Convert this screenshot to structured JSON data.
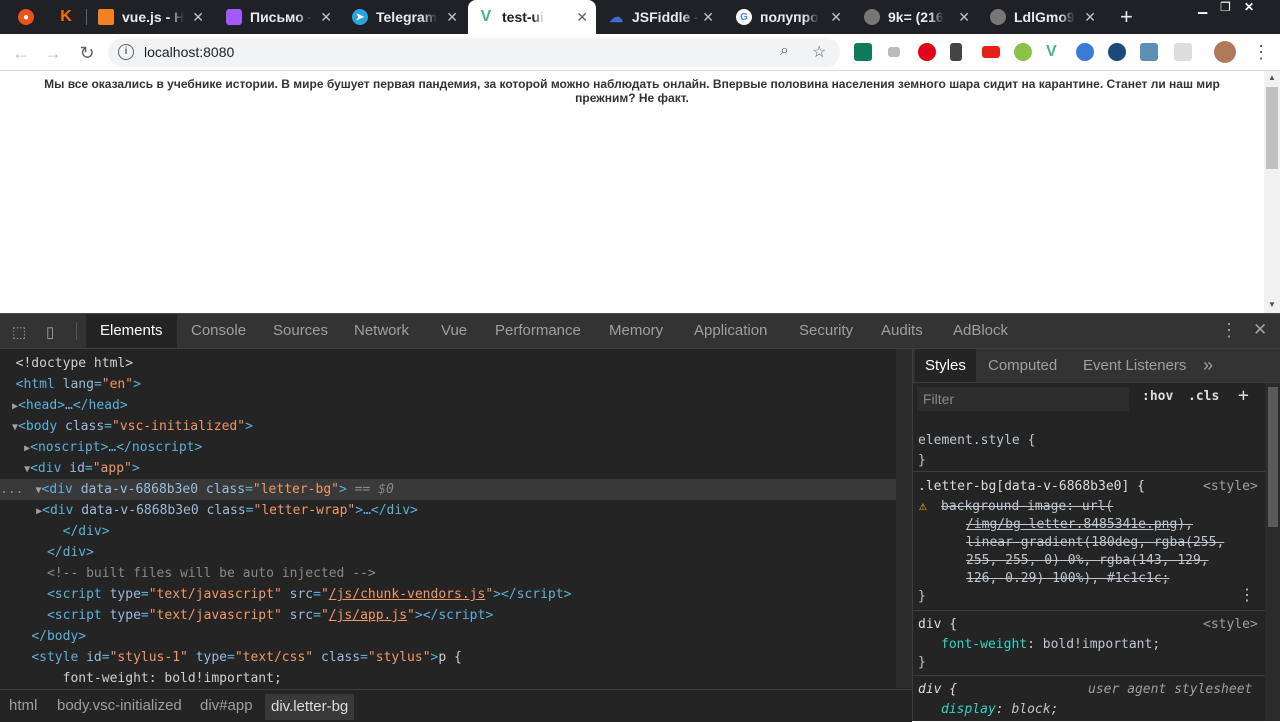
{
  "browser": {
    "tabs": [
      {
        "label": "",
        "icon": "firefox-like-icon",
        "color": "#e8541c"
      },
      {
        "label": "K",
        "icon": "k-icon",
        "color": "#ff6c00"
      },
      {
        "label": "vue.js - Н",
        "icon": "stackoverflow-icon",
        "color": "#f48024"
      },
      {
        "label": "Письмо -",
        "icon": "figma-icon",
        "color": "#a259ff"
      },
      {
        "label": "Telegram",
        "icon": "telegram-icon",
        "color": "#2aa3df"
      },
      {
        "label": "test-ui",
        "icon": "vue-icon",
        "color": "#41b883"
      },
      {
        "label": "JSFiddle -",
        "icon": "jsfiddle-icon",
        "color": "#3b6ed6"
      },
      {
        "label": "полупро",
        "icon": "google-icon",
        "color": "#4285f4"
      },
      {
        "label": "9k= (216",
        "icon": "globe-icon",
        "color": "#777"
      },
      {
        "label": "LdlGmo9",
        "icon": "globe-icon",
        "color": "#777"
      }
    ],
    "new_tab": "+",
    "url": "localhost:8080"
  },
  "page": {
    "paragraph": "Мы все оказались в учебнике истории. В мире бушует первая пандемия, за которой можно наблюдать онлайн. Впервые половина населения земного шара сидит на карантине. Станет ли наш мир прежним? Не факт."
  },
  "devtools": {
    "tabs": [
      "Elements",
      "Console",
      "Sources",
      "Network",
      "Vue",
      "Performance",
      "Memory",
      "Application",
      "Security",
      "Audits",
      "AdBlock"
    ],
    "dom": {
      "doctype": "<!doctype html>",
      "html_tag": "html",
      "html_attr": "lang",
      "html_val": "\"en\"",
      "head": "head",
      "head_ellipsis": "…</head>",
      "body_attr": "class",
      "body_val": "\"vsc-initialized\"",
      "noscript": "noscript",
      "noscript_ellipsis": "…</noscript>",
      "div_app_attr": "id",
      "div_app_val": "\"app\"",
      "sel_attr1": "data-v-6868b3e0",
      "sel_attr2": "class",
      "sel_val2": "\"letter-bg\"",
      "sel_marker": "== $0",
      "wrap_val": "\"letter-wrap\"",
      "wrap_ellipsis": "…</div>",
      "close_div": "</div>",
      "comment": "<!-- built files will be auto injected -->",
      "script_type": "\"text/javascript\"",
      "script1_src": "/js/chunk-vendors.js",
      "script2_src": "/js/app.js",
      "close_body": "</body>",
      "style_id": "\"stylus-1\"",
      "style_type": "\"text/css\"",
      "style_class": "\"stylus\"",
      "style_text": "p {",
      "style_rule": "font-weight: bold!important;"
    },
    "breadcrumbs": [
      "html",
      "body.vsc-initialized",
      "div#app",
      "div.letter-bg"
    ],
    "styles_panel": {
      "tabs": [
        "Styles",
        "Computed",
        "Event Listeners"
      ],
      "filter_placeholder": "Filter",
      "hov": ":hov",
      "cls": ".cls",
      "rules": {
        "element_style": "element.style {",
        "close": "}",
        "letter_selector": ".letter-bg[data-v-6868b3e0] {",
        "source_style": "<style>",
        "bg_prop": "background-image",
        "bg_url": "/img/bg-letter.8485341e.png",
        "bg_line2": "linear-gradient(180deg, rgba(255,",
        "bg_line3": "255, 255, 0) 0%, rgba(143, 129,",
        "bg_line4": "126, 0.29) 100%), #1c1c1c;",
        "div_selector": "div {",
        "fw_prop": "font-weight",
        "fw_val": "bold!important;",
        "ua_label": "user agent stylesheet",
        "display_prop": "display",
        "display_val": "block;"
      }
    }
  }
}
